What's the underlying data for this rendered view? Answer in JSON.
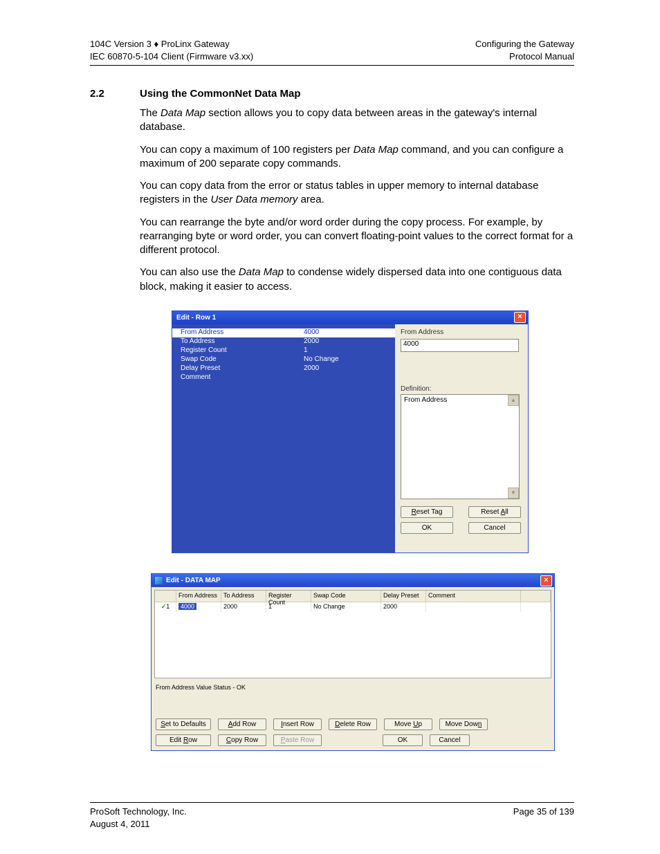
{
  "header": {
    "left1a": "104C Version 3 ",
    "left1b": "♦",
    "left1c": " ProLinx Gateway",
    "left2": "IEC 60870-5-104 Client (Firmware v3.xx)",
    "right1": "Configuring the  Gateway",
    "right2": "Protocol Manual"
  },
  "section": {
    "num": "2.2",
    "title": "Using the CommonNet Data Map",
    "p1a": "The ",
    "p1i": "Data Map",
    "p1b": " section allows you to copy data between areas in the gateway's internal database.",
    "p2a": "You can copy a maximum of 100 registers per ",
    "p2i": "Data Map",
    "p2b": " command, and you can configure a maximum of 200 separate copy commands.",
    "p3a": "You can copy data from the error or status tables in upper memory to internal database registers in the ",
    "p3i": "User Data memory",
    "p3b": " area.",
    "p4": "You can rearrange the byte and/or word order during the copy process. For example, by rearranging byte or word order, you can convert floating-point values to the correct format for a different protocol.",
    "p5a": "You can also use the ",
    "p5i": "Data Map",
    "p5b": " to condense widely dispersed data into one contiguous data block, making it easier to access."
  },
  "dlg1": {
    "title": "Edit - Row 1",
    "rows": [
      {
        "k": "From Address",
        "v": "4000"
      },
      {
        "k": "To Address",
        "v": "2000"
      },
      {
        "k": "Register Count",
        "v": "1"
      },
      {
        "k": "Swap Code",
        "v": "No Change"
      },
      {
        "k": "Delay Preset",
        "v": "2000"
      },
      {
        "k": "Comment",
        "v": ""
      }
    ],
    "group_label": "From Address",
    "input_value": "4000",
    "definition_label": "Definition:",
    "definition_text": "From Address",
    "btn_reset_tag_pre": "R",
    "btn_reset_tag_rest": "eset Tag",
    "btn_reset_all_pre": "Reset ",
    "btn_reset_all_u": "A",
    "btn_reset_all_post": "ll",
    "btn_ok": "OK",
    "btn_cancel": "Cancel"
  },
  "dlg2": {
    "title": "Edit - DATA MAP",
    "headers": [
      "",
      "From Address",
      "To Address",
      "Register Count",
      "Swap Code",
      "Delay Preset",
      "Comment",
      ""
    ],
    "row": {
      "check": "✓",
      "num": "1",
      "from": "4000",
      "to": "2000",
      "cnt": "1",
      "swap": "No Change",
      "delay": "2000",
      "comment": ""
    },
    "status": "From Address Value Status - OK",
    "buttons": {
      "set_defaults_u": "S",
      "set_defaults_r": "et to Defaults",
      "add_row_u": "A",
      "add_row_r": "dd Row",
      "insert_row_u": "I",
      "insert_row_r": "nsert Row",
      "delete_row_u": "D",
      "delete_row_r": "elete Row",
      "move_up_pre": "Move ",
      "move_up_u": "U",
      "move_up_post": "p",
      "move_down_pre": "Move Dow",
      "move_down_u": "n",
      "move_down_post": "",
      "edit_row_pre": "Edit ",
      "edit_row_u": "R",
      "edit_row_post": "ow",
      "copy_row_u": "C",
      "copy_row_r": "opy Row",
      "paste_row_u": "P",
      "paste_row_r": "aste Row",
      "ok": "OK",
      "cancel": "Cancel"
    }
  },
  "footer": {
    "company": "ProSoft Technology, Inc.",
    "date": "August 4, 2011",
    "page": "Page 35 of 139"
  }
}
